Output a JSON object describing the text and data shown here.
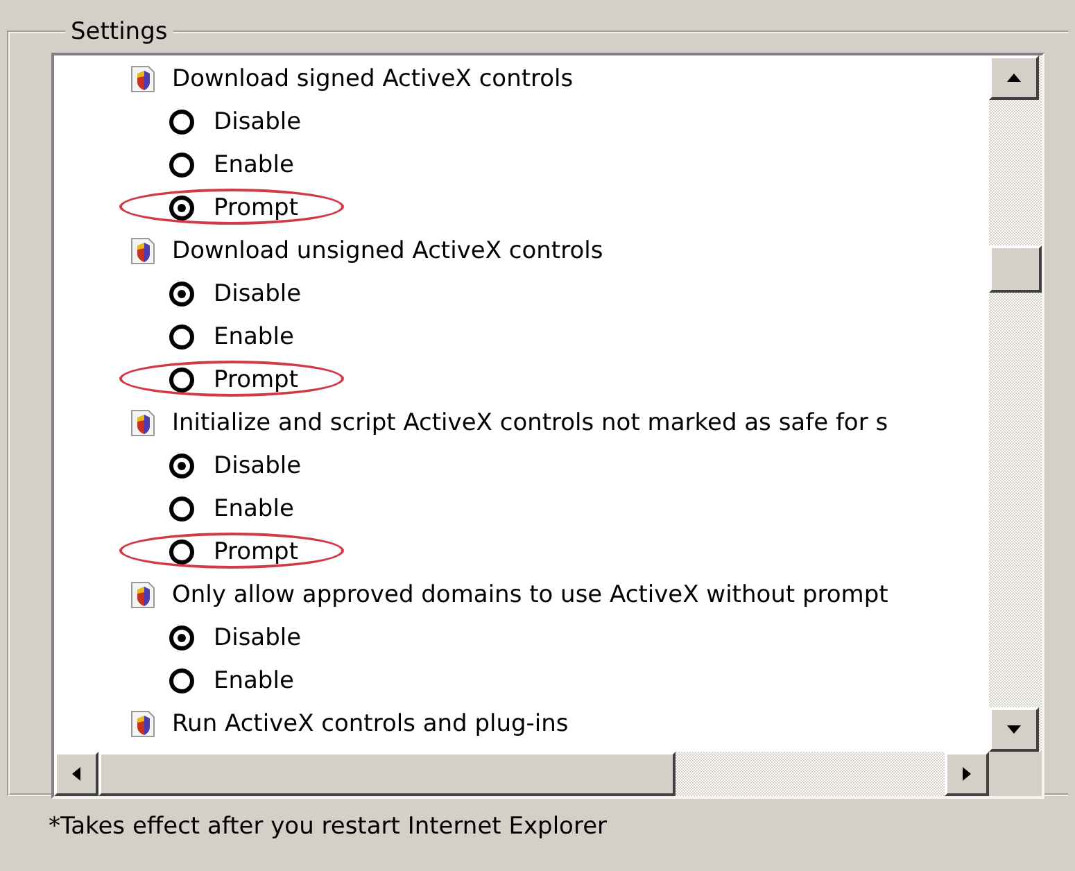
{
  "group": {
    "title": "Settings"
  },
  "settings": [
    {
      "label": "Download signed ActiveX controls",
      "options": [
        {
          "label": "Disable",
          "selected": false,
          "highlighted": false
        },
        {
          "label": "Enable",
          "selected": false,
          "highlighted": false
        },
        {
          "label": "Prompt",
          "selected": true,
          "highlighted": true
        }
      ]
    },
    {
      "label": "Download unsigned ActiveX controls",
      "options": [
        {
          "label": "Disable",
          "selected": true,
          "highlighted": false
        },
        {
          "label": "Enable",
          "selected": false,
          "highlighted": false
        },
        {
          "label": "Prompt",
          "selected": false,
          "highlighted": true
        }
      ]
    },
    {
      "label": "Initialize and script ActiveX controls not marked as safe for s",
      "options": [
        {
          "label": "Disable",
          "selected": true,
          "highlighted": false
        },
        {
          "label": "Enable",
          "selected": false,
          "highlighted": false
        },
        {
          "label": "Prompt",
          "selected": false,
          "highlighted": true
        }
      ]
    },
    {
      "label": "Only allow approved domains to use ActiveX without prompt",
      "options": [
        {
          "label": "Disable",
          "selected": true,
          "highlighted": false
        },
        {
          "label": "Enable",
          "selected": false,
          "highlighted": false
        }
      ]
    },
    {
      "label": "Run ActiveX controls and plug-ins"
    }
  ],
  "footnote": "*Takes effect after you restart Internet Explorer"
}
